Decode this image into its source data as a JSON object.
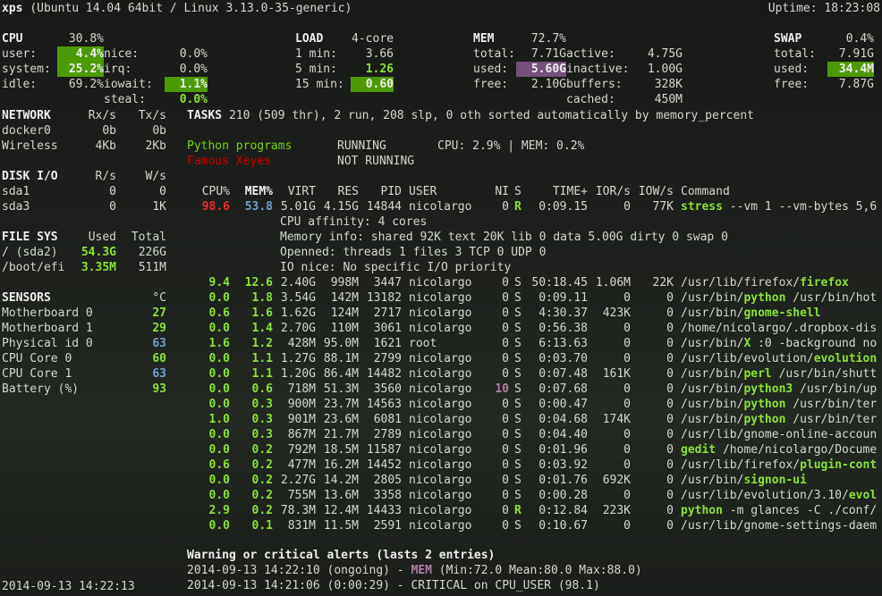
{
  "header": {
    "host": "xps",
    "system": "(Ubuntu 14.04 64bit / Linux 3.13.0-35-generic)",
    "uptime": "Uptime: 18:23:08"
  },
  "cpu": {
    "title": "CPU",
    "total": "30.8%",
    "rows": [
      [
        "user:",
        "4.4%",
        "nice:",
        "0.0%"
      ],
      [
        "system:",
        "25.2%",
        "irq:",
        "0.0%"
      ],
      [
        "idle:",
        "69.2%",
        "iowait:",
        "1.1%"
      ],
      [
        "",
        "",
        "steal:",
        "0.0%"
      ]
    ]
  },
  "load": {
    "title": "LOAD",
    "cores": "4-core",
    "rows": [
      [
        "1 min:",
        "3.66"
      ],
      [
        "5 min:",
        "1.26"
      ],
      [
        "15 min:",
        "0.60"
      ]
    ]
  },
  "mem": {
    "title": "MEM",
    "percent": "72.7%",
    "rows": [
      [
        "total:",
        "7.71G",
        "active:",
        "4.75G"
      ],
      [
        "used:",
        "5.60G",
        "inactive:",
        "1.00G"
      ],
      [
        "free:",
        "2.10G",
        "buffers:",
        "328K"
      ],
      [
        "",
        "",
        "cached:",
        "450M"
      ]
    ]
  },
  "swap": {
    "title": "SWAP",
    "percent": "0.4%",
    "rows": [
      [
        "total:",
        "7.91G"
      ],
      [
        "used:",
        "34.4M"
      ],
      [
        "free:",
        "7.87G"
      ]
    ]
  },
  "network": {
    "title": "NETWORK",
    "rx": "Rx/s",
    "tx": "Tx/s",
    "rows": [
      [
        "docker0",
        "0b",
        "0b"
      ],
      [
        "Wireless",
        "4Kb",
        "2Kb"
      ]
    ]
  },
  "disk": {
    "title": "DISK I/O",
    "r": "R/s",
    "w": "W/s",
    "rows": [
      [
        "sda1",
        "0",
        "0"
      ],
      [
        "sda3",
        "0",
        "1K"
      ]
    ]
  },
  "fs": {
    "title": "FILE SYS",
    "used": "Used",
    "total": "Total",
    "rows": [
      [
        "/ (sda2)",
        "54.3G",
        "226G"
      ],
      [
        "/boot/efi",
        "3.35M",
        "511M"
      ]
    ]
  },
  "sensors": {
    "title": "SENSORS",
    "unit": "°C",
    "rows": [
      [
        "Motherboard 0",
        "27",
        "gr"
      ],
      [
        "Motherboard 1",
        "29",
        "gr"
      ],
      [
        "Physical id 0",
        "63",
        "bl"
      ],
      [
        "CPU Core 0",
        "60",
        "gr"
      ],
      [
        "CPU Core 1",
        "63",
        "bl"
      ],
      [
        "Battery (%)",
        "93",
        "gr"
      ]
    ]
  },
  "tasks": {
    "title": "TASKS",
    "summary": "210 (509 thr), 2 run, 208 slp, 0 oth sorted automatically by memory_percent"
  },
  "monitor": [
    {
      "name": "Python programs",
      "state": "RUNNING",
      "info": "CPU: 2.9% | MEM: 0.2%",
      "color": "gn"
    },
    {
      "name": "Famous Xeyes",
      "state": "NOT RUNNING",
      "info": "",
      "color": "rdn"
    }
  ],
  "proc_header": [
    "CPU%",
    "MEM%",
    "VIRT",
    "RES",
    "PID",
    "USER",
    "NI",
    "S",
    "TIME+",
    "IOR/s",
    "IOW/s",
    "Command"
  ],
  "proc_first": {
    "cpu": "98.6",
    "mem": "53.8",
    "virt": "5.01G",
    "res": "4.15G",
    "pid": "14844",
    "user": "nicolargo",
    "ni": "0",
    "s": "R",
    "time": "0:09.15",
    "ior": "0",
    "iow": "77K",
    "cmd_prefix": "",
    "cmd_name": "stress",
    "cmd_args": " --vm 1 --vm-bytes 5,6"
  },
  "proc_details": [
    "CPU affinity: 4 cores",
    "Memory info: shared 92K text 20K lib 0 data 5.00G dirty 0 swap 0",
    "Openned: threads 1 files 3 TCP 0 UDP 0",
    "IO nice: No specific I/O priority"
  ],
  "processes": [
    [
      "9.4",
      "12.6",
      "2.40G",
      "998M",
      "3447",
      "nicolargo",
      "0",
      "S",
      "50:18.45",
      "1.06M",
      "22K",
      "/usr/lib/firefox/",
      "firefox",
      ""
    ],
    [
      "0.0",
      "1.8",
      "3.54G",
      "142M",
      "13182",
      "nicolargo",
      "0",
      "S",
      "0:09.11",
      "0",
      "0",
      "/usr/bin/",
      "python",
      " /usr/bin/hot"
    ],
    [
      "0.6",
      "1.6",
      "1.62G",
      "124M",
      "2717",
      "nicolargo",
      "0",
      "S",
      "4:30.37",
      "423K",
      "0",
      "/usr/bin/",
      "gnome-shell",
      ""
    ],
    [
      "0.0",
      "1.4",
      "2.70G",
      "110M",
      "3061",
      "nicolargo",
      "0",
      "S",
      "0:56.38",
      "0",
      "0",
      "/home/nicolargo/.dropbox-dis",
      "",
      ""
    ],
    [
      "1.6",
      "1.2",
      "428M",
      "95.0M",
      "1621",
      "root",
      "0",
      "S",
      "6:13.63",
      "0",
      "0",
      "/usr/bin/",
      "X",
      " :0 -background no"
    ],
    [
      "0.0",
      "1.1",
      "1.27G",
      "88.1M",
      "2799",
      "nicolargo",
      "0",
      "S",
      "0:03.70",
      "0",
      "0",
      "/usr/lib/evolution/",
      "evolution",
      ""
    ],
    [
      "0.0",
      "1.1",
      "1.20G",
      "86.4M",
      "14482",
      "nicolargo",
      "0",
      "S",
      "0:07.48",
      "161K",
      "0",
      "/usr/bin/",
      "perl",
      " /usr/bin/shutt"
    ],
    [
      "0.0",
      "0.6",
      "718M",
      "51.3M",
      "3560",
      "nicolargo",
      "10",
      "S",
      "0:07.68",
      "0",
      "0",
      "/usr/bin/",
      "python3",
      " /usr/bin/up"
    ],
    [
      "0.0",
      "0.3",
      "900M",
      "23.7M",
      "14563",
      "nicolargo",
      "0",
      "S",
      "0:00.47",
      "0",
      "0",
      "/usr/bin/",
      "python",
      " /usr/bin/ter"
    ],
    [
      "1.0",
      "0.3",
      "901M",
      "23.6M",
      "6081",
      "nicolargo",
      "0",
      "S",
      "0:04.68",
      "174K",
      "0",
      "/usr/bin/",
      "python",
      " /usr/bin/ter"
    ],
    [
      "0.0",
      "0.3",
      "867M",
      "21.7M",
      "2789",
      "nicolargo",
      "0",
      "S",
      "0:04.40",
      "0",
      "0",
      "/usr/lib/gnome-online-accoun",
      "",
      ""
    ],
    [
      "0.0",
      "0.2",
      "792M",
      "18.5M",
      "11587",
      "nicolargo",
      "0",
      "S",
      "0:01.96",
      "0",
      "0",
      "",
      "gedit",
      " /home/nicolargo/Docume"
    ],
    [
      "0.6",
      "0.2",
      "477M",
      "16.2M",
      "14452",
      "nicolargo",
      "0",
      "S",
      "0:03.92",
      "0",
      "0",
      "/usr/lib/firefox/",
      "plugin-cont",
      ""
    ],
    [
      "0.0",
      "0.2",
      "2.27G",
      "14.2M",
      "2805",
      "nicolargo",
      "0",
      "S",
      "0:01.76",
      "692K",
      "0",
      "/usr/bin/",
      "signon-ui",
      ""
    ],
    [
      "0.0",
      "0.2",
      "755M",
      "13.6M",
      "3358",
      "nicolargo",
      "0",
      "S",
      "0:00.28",
      "0",
      "0",
      "/usr/lib/evolution/3.10/",
      "evol",
      ""
    ],
    [
      "2.9",
      "0.2",
      "78.3M",
      "12.4M",
      "14433",
      "nicolargo",
      "0",
      "R",
      "0:12.84",
      "223K",
      "0",
      "",
      "python",
      " -m glances -C ./conf/"
    ],
    [
      "0.0",
      "0.1",
      "831M",
      "11.5M",
      "2591",
      "nicolargo",
      "0",
      "S",
      "0:10.67",
      "0",
      "0",
      "/usr/lib/gnome-settings-daem",
      "",
      ""
    ]
  ],
  "alerts": {
    "title": "Warning or critical alerts (lasts 2 entries)",
    "entries": [
      {
        "time": "2014-09-13 14:22:10 (ongoing) - ",
        "key": "MEM",
        "rest": " (Min:72.0 Mean:80.0 Max:88.0)"
      },
      {
        "time": "2014-09-13 14:21:06 (0:00:29) - ",
        "key": "",
        "rest": "CRITICAL on CPU_USER (98.1)"
      }
    ]
  },
  "footer": {
    "datetime": "2014-09-13 14:22:13"
  }
}
